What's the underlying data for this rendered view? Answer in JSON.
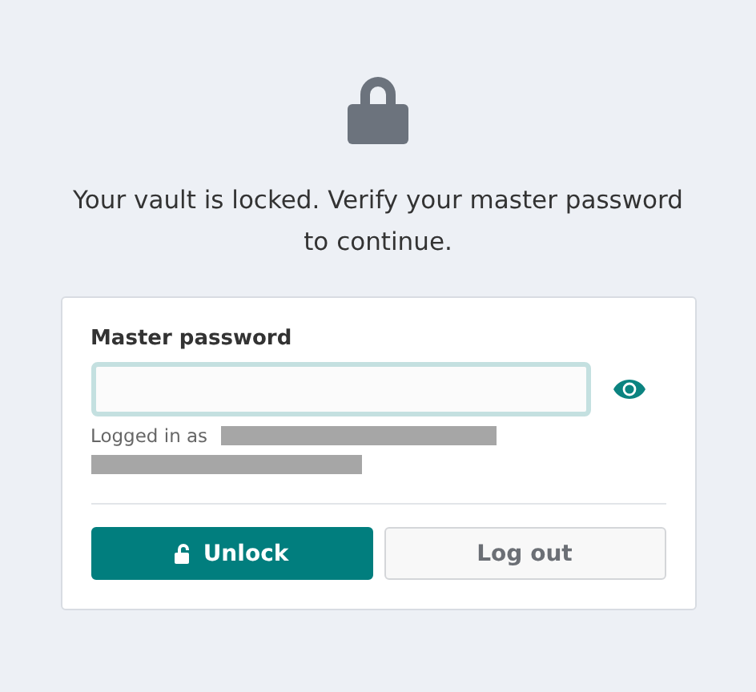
{
  "message": "Your vault is locked. Verify your master password to continue.",
  "password_field": {
    "label": "Master password",
    "focused": true
  },
  "logged_in": {
    "label": "Logged in as"
  },
  "buttons": [
    {
      "label": "Unlock",
      "kind": "primary"
    },
    {
      "label": "Log out",
      "kind": "secondary"
    }
  ]
}
